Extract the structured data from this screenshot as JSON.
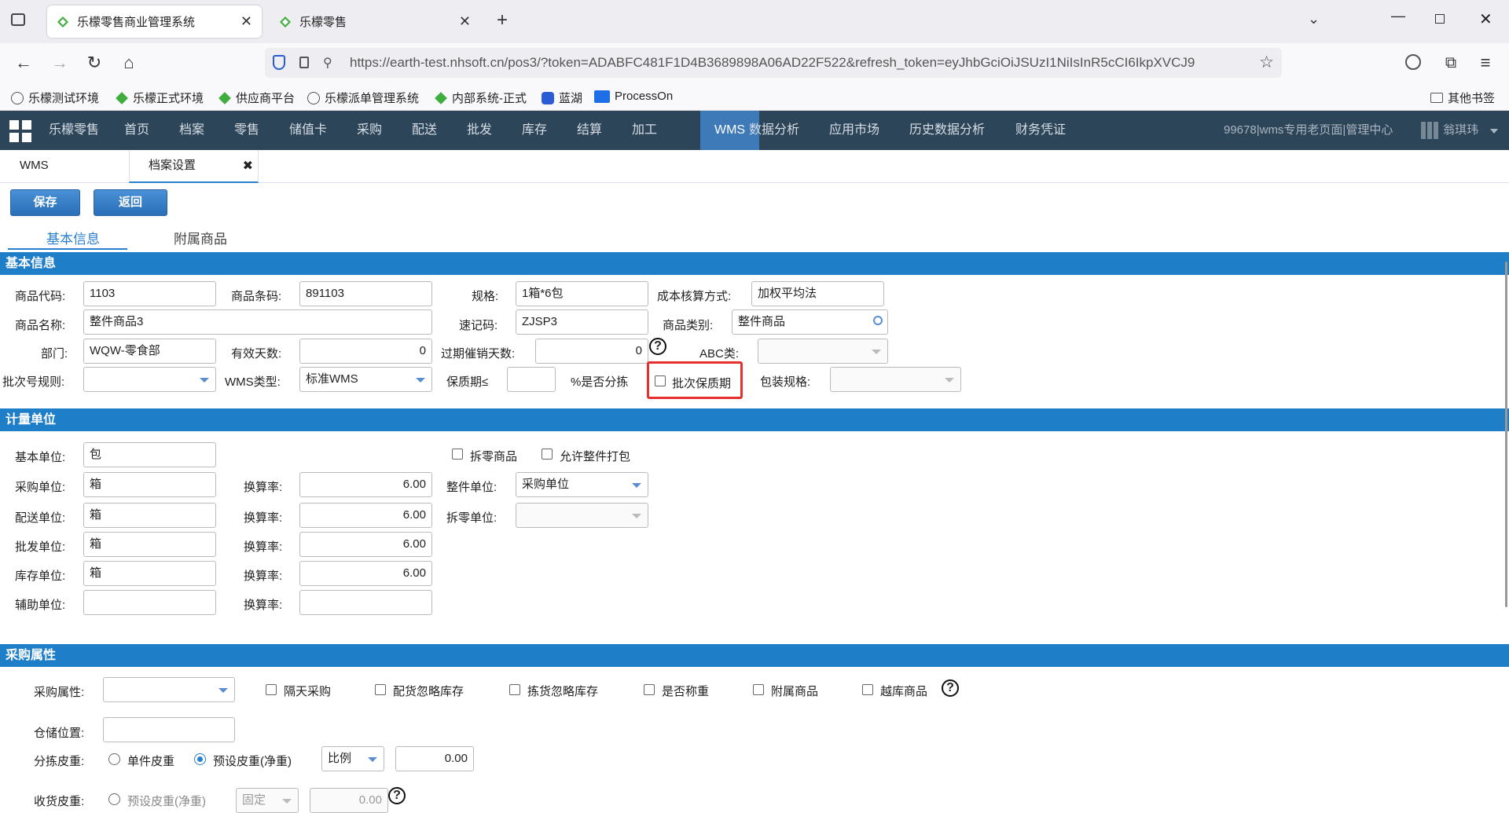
{
  "browser": {
    "tabs": [
      {
        "title": "乐檬零售商业管理系统",
        "active": true
      },
      {
        "title": "乐檬零售",
        "active": false
      }
    ],
    "url": "https://earth-test.nhsoft.cn/pos3/?token=ADABFC481F1D4B3689898A06AD22F522&refresh_token=eyJhbGciOiJSUzI1NiIsInR5cCI6IkpXVCJ9",
    "bookmarks": [
      "乐檬测试环境",
      "乐檬正式环境",
      "供应商平台",
      "乐檬派单管理系统",
      "内部系统-正式",
      "蓝湖",
      "ProcessOn"
    ],
    "other_bookmarks": "其他书签"
  },
  "appnav": {
    "items": [
      "乐檬零售",
      "首页",
      "档案",
      "零售",
      "储值卡",
      "采购",
      "配送",
      "批发",
      "库存",
      "结算",
      "加工",
      "WMS",
      "数据分析",
      "应用市场",
      "历史数据分析",
      "财务凭证"
    ],
    "active": "WMS",
    "user_info": "99678|wms专用老页面|管理中心",
    "user_name": "翁琪玮"
  },
  "pagetabs": [
    "WMS",
    "档案设置"
  ],
  "buttons": {
    "save": "保存",
    "back": "返回"
  },
  "subtabs": [
    "基本信息",
    "附属商品"
  ],
  "basic": {
    "section": "基本信息",
    "code_label": "商品代码:",
    "code": "1103",
    "barcode_label": "商品条码:",
    "barcode": "891103",
    "spec_label": "规格:",
    "spec": "1箱*6包",
    "cost_label": "成本核算方式:",
    "cost": "加权平均法",
    "name_label": "商品名称:",
    "name": "整件商品3",
    "mnemonic_label": "速记码:",
    "mnemonic": "ZJSP3",
    "category_label": "商品类别:",
    "category": "整件商品",
    "dept_label": "部门:",
    "dept": "WQW-零食部",
    "valid_days_label": "有效天数:",
    "valid_days": "0",
    "expire_promo_label": "过期催销天数:",
    "expire_promo": "0",
    "abc_label": "ABC类:",
    "abc": "",
    "batch_rule_label": "批次号规则:",
    "batch_rule": "",
    "wms_type_label": "WMS类型:",
    "wms_type": "标准WMS",
    "shelf_label": "保质期≤",
    "shelf": "",
    "split_label": "%是否分拣",
    "batch_shelf_label": "批次保质期",
    "pack_spec_label": "包装规格:",
    "pack_spec": ""
  },
  "units": {
    "section": "计量单位",
    "base_label": "基本单位:",
    "base": "包",
    "split_goods": "拆零商品",
    "allow_pack": "允许整件打包",
    "rows": [
      {
        "label": "采购单位:",
        "unit": "箱",
        "rate_label": "换算率:",
        "rate": "6.00"
      },
      {
        "label": "配送单位:",
        "unit": "箱",
        "rate_label": "换算率:",
        "rate": "6.00"
      },
      {
        "label": "批发单位:",
        "unit": "箱",
        "rate_label": "换算率:",
        "rate": "6.00"
      },
      {
        "label": "库存单位:",
        "unit": "箱",
        "rate_label": "换算率:",
        "rate": "6.00"
      },
      {
        "label": "辅助单位:",
        "unit": "",
        "rate_label": "换算率:",
        "rate": ""
      }
    ],
    "whole_unit_label": "整件单位:",
    "whole_unit": "采购单位",
    "split_unit_label": "拆零单位:",
    "split_unit": ""
  },
  "purchase": {
    "section": "采购属性",
    "attr_label": "采购属性:",
    "attr": "",
    "checks": [
      "隔天采购",
      "配货忽略库存",
      "拣货忽略库存",
      "是否称重",
      "附属商品",
      "越库商品"
    ],
    "storage_label": "仓储位置:",
    "storage": "",
    "tare_label": "分拣皮重:",
    "tare_opt1": "单件皮重",
    "tare_opt2": "预设皮重(净重)",
    "tare_mode": "比例",
    "tare_value": "0.00",
    "recv_label": "收货皮重:",
    "recv_opt": "预设皮重(净重)",
    "recv_mode": "固定",
    "recv_value": "0.00"
  }
}
